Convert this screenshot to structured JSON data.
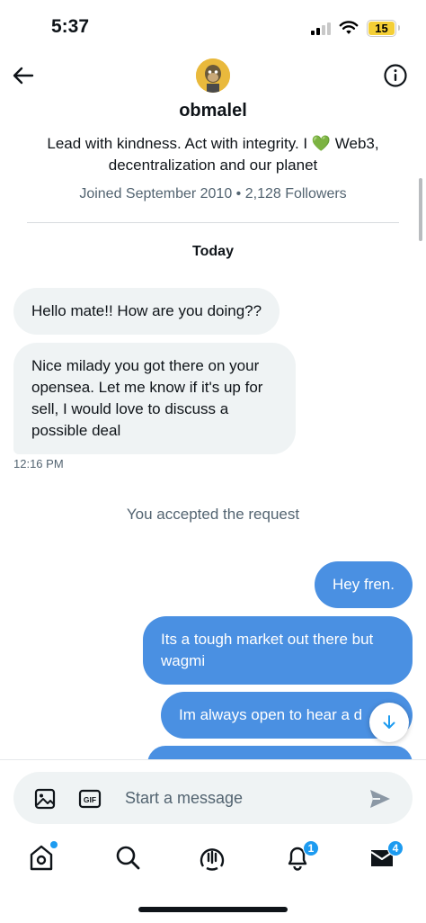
{
  "status_bar": {
    "time": "5:37",
    "battery": "15",
    "battery_color": "#f4cf36"
  },
  "header": {
    "back_icon": "arrow-left-icon",
    "info_icon": "info-circle-icon",
    "username": "obmalel",
    "bio_part1": "Lead with kindness. Act with integrity. I ",
    "bio_emoji": "💚",
    "bio_part2": " Web3, decentralization and our planet",
    "meta": "Joined September 2010 • 2,128 Followers"
  },
  "conversation": {
    "date_label": "Today",
    "incoming": [
      {
        "text": "Hello mate!! How are you doing??"
      },
      {
        "text": "Nice milady you got there on your opensea. Let me know if it's up for sell, I would love to discuss a possible deal"
      }
    ],
    "incoming_time": "12:16 PM",
    "system_message": "You accepted the request",
    "outgoing": [
      {
        "text": "Hey fren."
      },
      {
        "text": "Its a tough market out there but wagmi"
      },
      {
        "text": "Im always open to hear a d"
      }
    ],
    "jump_icon": "arrow-down-icon",
    "outgoing_color": "#4a90e2"
  },
  "composer": {
    "image_icon": "image-icon",
    "gif_icon": "gif-icon",
    "gif_label": "GIF",
    "placeholder": "Start a message",
    "send_icon": "send-icon"
  },
  "nav": {
    "home_icon": "home-icon",
    "search_icon": "search-icon",
    "spaces_icon": "spaces-icon",
    "notifications_icon": "bell-icon",
    "notifications_badge": "1",
    "messages_icon": "envelope-icon",
    "messages_badge": "4",
    "accent": "#1d9bf0"
  }
}
